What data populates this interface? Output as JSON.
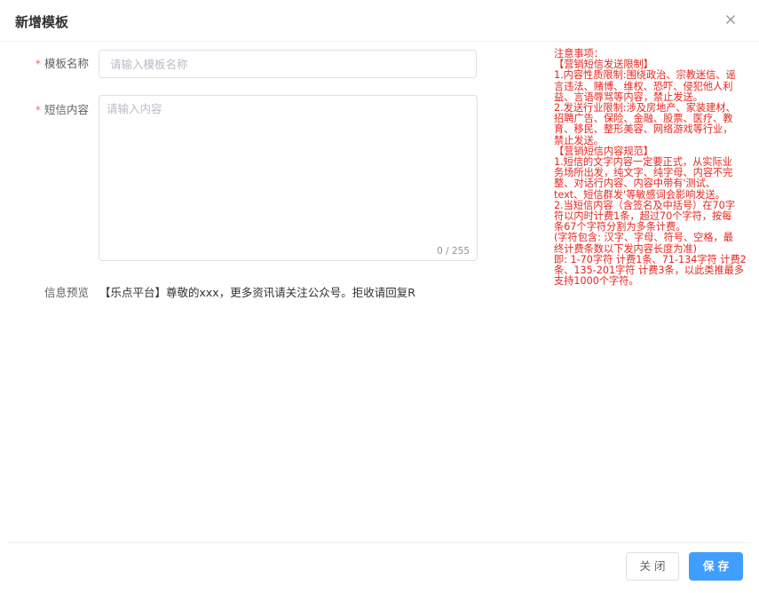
{
  "dialog": {
    "title": "新增模板"
  },
  "form": {
    "name_label": "模板名称",
    "name_placeholder": "请输入模板名称",
    "content_label": "短信内容",
    "content_placeholder": "请输入内容",
    "content_counter": "0 / 255",
    "required_mark": "*",
    "preview_label": "信息预览",
    "preview_text": "【乐点平台】尊敬的xxx，更多资讯请关注公众号。拒收请回复R"
  },
  "notes": {
    "lines": [
      "注意事项：",
      "【营销短信发送限制】",
      "1.内容性质限制:围绕政治、宗教迷信、谣",
      "言违法、赌博、维权、恐吓、侵犯他人利",
      "益、言语辱骂等内容，禁止发送。",
      "2.发送行业限制:涉及房地产、家装建材、",
      "招聘广告、保险、金融、股票、医疗、教",
      "育、移民、整形美容、网络游戏等行业，",
      "禁止发送。",
      "【营销短信内容规范】",
      "1.短信的文字内容一定要正式，从实际业",
      "务场所出发，纯文字、纯字母、内容不完",
      "整、对话行内容、内容中带有'测试、",
      "text、短信群发'等敏感词会影响发送。",
      "2.当短信内容（含签名及中括号）在70字",
      "符以内时计费1条，超过70个字符，按每",
      "条67个字符分割为多条计费。",
      "(字符包含: 汉字、字母、符号、空格，最",
      "终计费条数以下发内容长度为准)",
      "即: 1-70字符 计费1条、71-134字符 计费2",
      "条、135-201字符 计费3条，以此类推最多",
      "支持1000个字符。"
    ]
  },
  "footer": {
    "close_label": "关 闭",
    "save_label": "保 存"
  }
}
